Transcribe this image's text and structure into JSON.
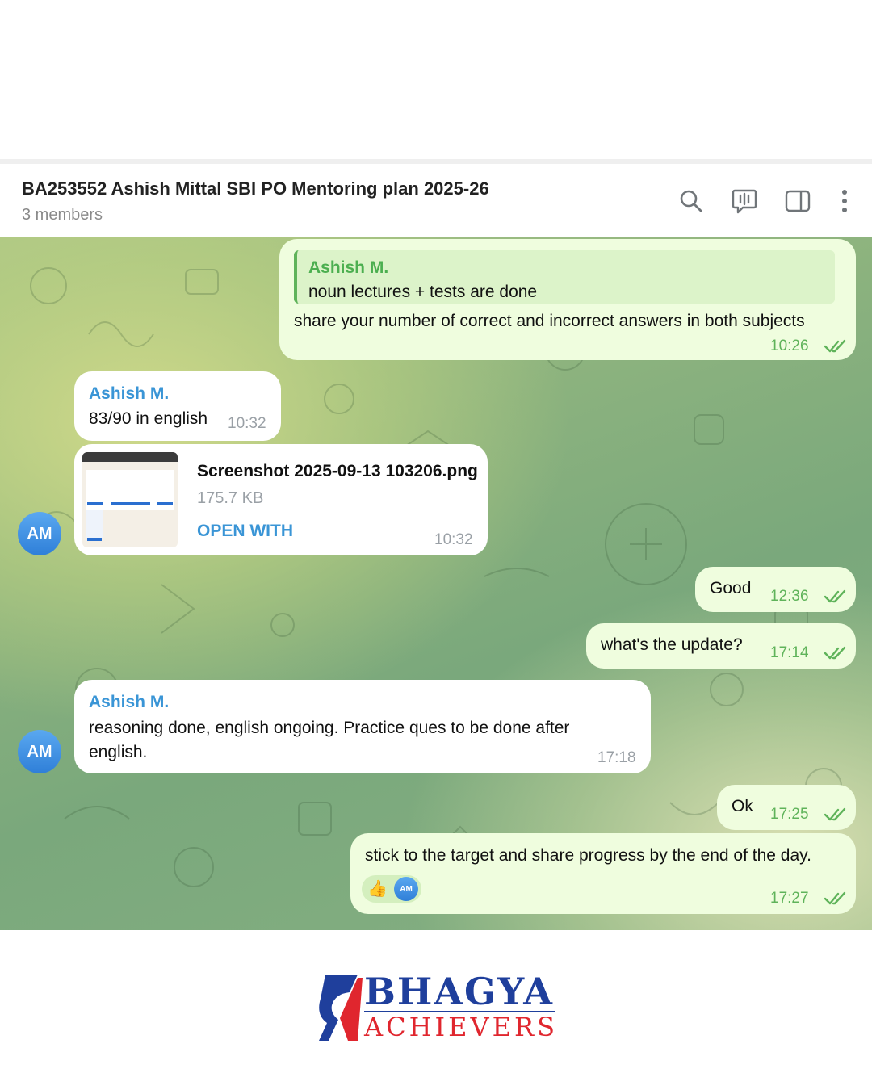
{
  "header": {
    "title": "BA253552 Ashish Mittal SBI PO Mentoring plan 2025-26",
    "members": "3 members",
    "icons": [
      "search-icon",
      "video-chat-icon",
      "sidebar-toggle-icon",
      "more-vertical-icon"
    ]
  },
  "messages": [
    {
      "direction": "out",
      "reply_sender": "Ashish M.",
      "reply_text": "noun lectures + tests are done",
      "text": "share your number of correct and incorrect answers in both subjects",
      "time": "10:26"
    },
    {
      "direction": "in",
      "sender": "Ashish M.",
      "text": "83/90 in english",
      "time": "10:32"
    },
    {
      "direction": "in",
      "file_name": "Screenshot 2025-09-13 103206.png",
      "file_size": "175.7 KB",
      "action": "OPEN WITH",
      "time": "10:32",
      "avatar": "AM"
    },
    {
      "direction": "out",
      "text": "Good",
      "time": "12:36"
    },
    {
      "direction": "out",
      "text": "what's the update?",
      "time": "17:14"
    },
    {
      "direction": "in",
      "sender": "Ashish M.",
      "text": "reasoning done, english ongoing. Practice ques to be done after english.",
      "time": "17:18",
      "avatar": "AM"
    },
    {
      "direction": "out",
      "text": "Ok",
      "time": "17:25"
    },
    {
      "direction": "out",
      "text": "stick to the target and share progress by the end of the day.",
      "reaction_emoji": "👍",
      "reaction_avatar": "AM",
      "time": "17:27"
    }
  ],
  "logo": {
    "line1": "BHAGYA",
    "line2": "ACHIEVERS"
  },
  "colors": {
    "accent": "#3a95d6",
    "outgoing": "#effdde",
    "brand_blue": "#1f3f9c",
    "brand_red": "#e0262e"
  }
}
